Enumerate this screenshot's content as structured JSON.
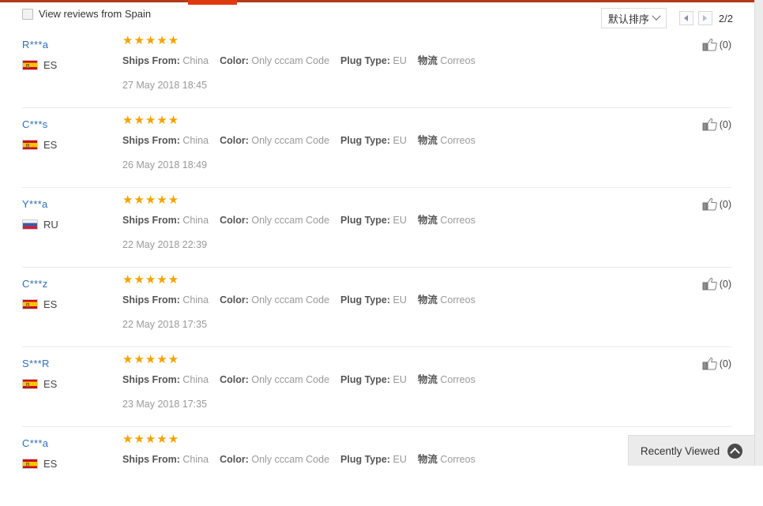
{
  "theme": {
    "accent_red": "#dd3b0f",
    "rule_red": "#b03a1a",
    "star_orange": "#f5a200",
    "link_blue": "#2e6fb8"
  },
  "filter_bar": {
    "view_reviews_label": "View reviews from Spain",
    "checkbox_checked": false,
    "checkbox_icon": "checkbox-unchecked-icon"
  },
  "sort": {
    "selected_label": "默认排序",
    "chevron_icon": "chevron-down-icon"
  },
  "pagination": {
    "prev_icon": "triangle-left-icon",
    "next_icon": "triangle-right-icon",
    "count_label": "2/2",
    "current_page": 2,
    "total_pages": 2
  },
  "reviews": [
    {
      "reviewer": "R***a",
      "country_code": "ES",
      "flag_icon": "flag-spain-icon",
      "rating": 5,
      "stars": "★★★★★",
      "attrs": [
        {
          "label": "Ships From:",
          "value": "China"
        },
        {
          "label": "Color:",
          "value": "Only cccam Code"
        },
        {
          "label": "Plug Type:",
          "value": "EU"
        },
        {
          "label": "物流",
          "value": "Correos"
        }
      ],
      "date": "27 May 2018 18:45",
      "helpful_icon": "thumbs-up-icon",
      "helpful_count": "(0)"
    },
    {
      "reviewer": "C***s",
      "country_code": "ES",
      "flag_icon": "flag-spain-icon",
      "rating": 5,
      "stars": "★★★★★",
      "attrs": [
        {
          "label": "Ships From:",
          "value": "China"
        },
        {
          "label": "Color:",
          "value": "Only cccam Code"
        },
        {
          "label": "Plug Type:",
          "value": "EU"
        },
        {
          "label": "物流",
          "value": "Correos"
        }
      ],
      "date": "26 May 2018 18:49",
      "helpful_icon": "thumbs-up-icon",
      "helpful_count": "(0)"
    },
    {
      "reviewer": "Y***a",
      "country_code": "RU",
      "flag_icon": "flag-russia-icon",
      "rating": 5,
      "stars": "★★★★★",
      "attrs": [
        {
          "label": "Ships From:",
          "value": "China"
        },
        {
          "label": "Color:",
          "value": "Only cccam Code"
        },
        {
          "label": "Plug Type:",
          "value": "EU"
        },
        {
          "label": "物流",
          "value": "Correos"
        }
      ],
      "date": "22 May 2018 22:39",
      "helpful_icon": "thumbs-up-icon",
      "helpful_count": "(0)"
    },
    {
      "reviewer": "C***z",
      "country_code": "ES",
      "flag_icon": "flag-spain-icon",
      "rating": 5,
      "stars": "★★★★★",
      "attrs": [
        {
          "label": "Ships From:",
          "value": "China"
        },
        {
          "label": "Color:",
          "value": "Only cccam Code"
        },
        {
          "label": "Plug Type:",
          "value": "EU"
        },
        {
          "label": "物流",
          "value": "Correos"
        }
      ],
      "date": "22 May 2018 17:35",
      "helpful_icon": "thumbs-up-icon",
      "helpful_count": "(0)"
    },
    {
      "reviewer": "S***R",
      "country_code": "ES",
      "flag_icon": "flag-spain-icon",
      "rating": 5,
      "stars": "★★★★★",
      "attrs": [
        {
          "label": "Ships From:",
          "value": "China"
        },
        {
          "label": "Color:",
          "value": "Only cccam Code"
        },
        {
          "label": "Plug Type:",
          "value": "EU"
        },
        {
          "label": "物流",
          "value": "Correos"
        }
      ],
      "date": "23 May 2018 17:35",
      "helpful_icon": "thumbs-up-icon",
      "helpful_count": "(0)"
    },
    {
      "reviewer": "C***a",
      "country_code": "ES",
      "flag_icon": "flag-spain-icon",
      "rating": 5,
      "stars": "★★★★★",
      "attrs": [
        {
          "label": "Ships From:",
          "value": "China"
        },
        {
          "label": "Color:",
          "value": "Only cccam Code"
        },
        {
          "label": "Plug Type:",
          "value": "EU"
        },
        {
          "label": "物流",
          "value": "Correos"
        }
      ],
      "date": "",
      "helpful_icon": "thumbs-up-icon",
      "helpful_count": ""
    }
  ],
  "recently_viewed": {
    "label": "Recently Viewed",
    "toggle_icon": "chevron-up-circle-icon"
  }
}
